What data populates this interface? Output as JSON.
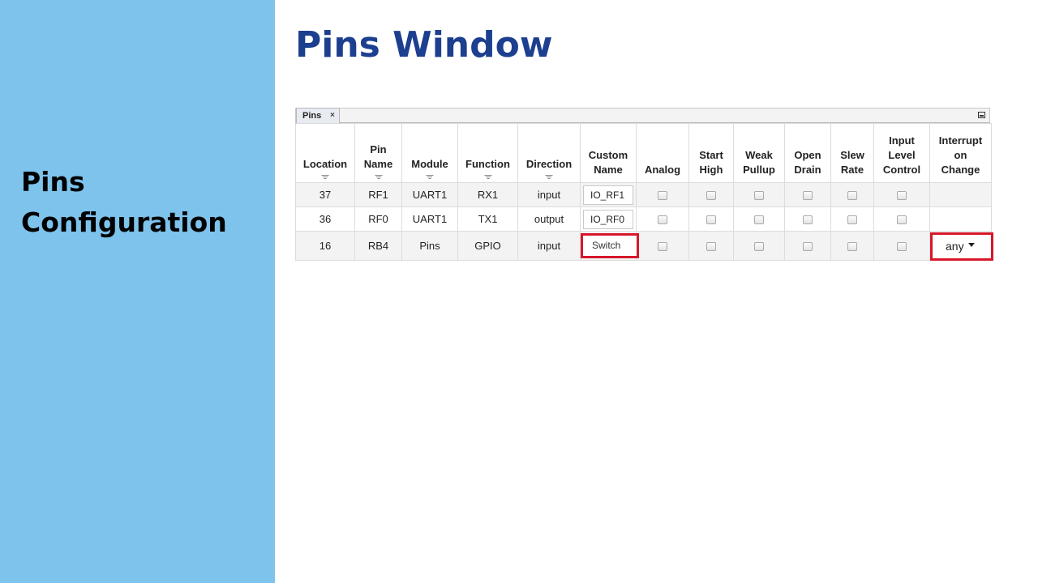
{
  "slide": {
    "title": "Pins Window",
    "sidebar_lines": [
      "Pins",
      "Configuration"
    ]
  },
  "panel": {
    "tab_label": "Pins",
    "tab_close": "×"
  },
  "table": {
    "headers": [
      {
        "lines": [
          "Location"
        ],
        "filter": true
      },
      {
        "lines": [
          "Pin",
          "Name"
        ],
        "filter": true
      },
      {
        "lines": [
          "Module"
        ],
        "filter": true
      },
      {
        "lines": [
          "Function"
        ],
        "filter": true
      },
      {
        "lines": [
          "Direction"
        ],
        "filter": true
      },
      {
        "lines": [
          "Custom",
          "Name"
        ],
        "filter": false
      },
      {
        "lines": [
          "Analog"
        ],
        "filter": false
      },
      {
        "lines": [
          "Start",
          "High"
        ],
        "filter": false
      },
      {
        "lines": [
          "Weak",
          "Pullup"
        ],
        "filter": false
      },
      {
        "lines": [
          "Open",
          "Drain"
        ],
        "filter": false
      },
      {
        "lines": [
          "Slew",
          "Rate"
        ],
        "filter": false
      },
      {
        "lines": [
          "Input",
          "Level",
          "Control"
        ],
        "filter": false
      },
      {
        "lines": [
          "Interrupt",
          "on",
          "Change"
        ],
        "filter": false
      }
    ],
    "rows": [
      {
        "location": "37",
        "pin_name": "RF1",
        "module": "UART1",
        "function": "RX1",
        "direction": "input",
        "custom_name": "IO_RF1",
        "ioc": ""
      },
      {
        "location": "36",
        "pin_name": "RF0",
        "module": "UART1",
        "function": "TX1",
        "direction": "output",
        "custom_name": "IO_RF0",
        "ioc": ""
      },
      {
        "location": "16",
        "pin_name": "RB4",
        "module": "Pins",
        "function": "GPIO",
        "direction": "input",
        "custom_name": "Switch",
        "ioc": "any"
      }
    ]
  },
  "colors": {
    "sidebar": "#7dc3ec",
    "title": "#1d3f8f",
    "highlight": "#d7172a"
  }
}
